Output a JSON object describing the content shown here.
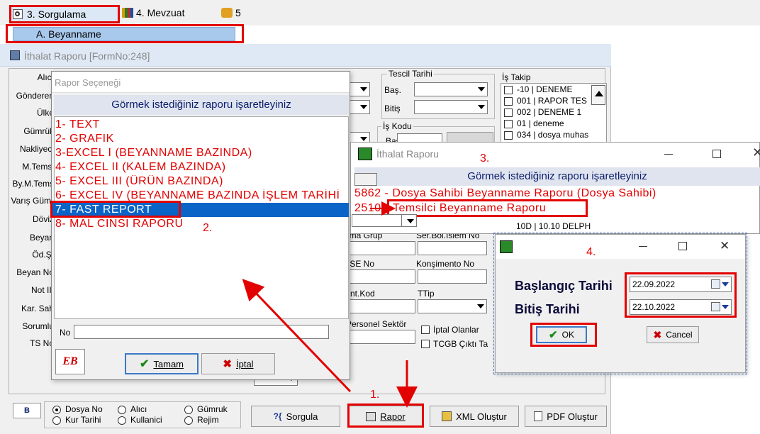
{
  "menu": {
    "sorgulama": "3.  Sorgulama",
    "mevzuat": "4.  Mevzuat",
    "five": "5",
    "beyanname": "A.  Beyanname"
  },
  "main_window": {
    "title": "İthalat Raporu [FormNo:248]",
    "left_labels": [
      "Alıcı",
      "Gönderen",
      "Ülke",
      "Gümrük",
      "Nakliyeci",
      "M.Temsi",
      "By.M.Tems",
      "Varış Gümr",
      "Döviz",
      "Beyan",
      "Öd.Ş.",
      "Beyan No",
      "Not III",
      "Kar. Sah",
      "Sorumlu",
      "TS No"
    ],
    "tescil_title": "Tescil Tarihi",
    "bas_label": "Baş.",
    "bitis_label": "Bitiş",
    "is_takip_title": "İş Takip",
    "is_takip_items": [
      "-10 | DENEME",
      "001 | RAPOR TES",
      "002 | DENEME 1",
      "01 | deneme",
      "034 | dosya muhas"
    ],
    "is_kodu_title": "İş Kodu",
    "bas2_label": "Baş",
    "list_item_10d": "10D | 10.10 DELPH",
    "firma_grup": "irma Grup",
    "ser_bol": "Ser.Bol.Islem No",
    "tse_no": "TSE No",
    "konsimento": "Konşimento No",
    "ant_kod": "Ant.Kod",
    "ttip": "TTip",
    "personel": "Personel Sektör",
    "iptal_olanlar": "İptal Olanlar",
    "tcgb": "TCGB Çıktı Ta",
    "radios": [
      "Dosya No",
      "Alıcı",
      "Gümruk",
      "Kur Tarihi",
      "Kullanici",
      "Rejim"
    ],
    "buttons": {
      "sorgula": "Sorgula",
      "rapor": "Rapor",
      "xml": "XML Oluştur",
      "pdf": "PDF Oluştur"
    }
  },
  "rapor_dialog": {
    "title": "Rapor Seçeneği",
    "header": "Görmek istediğiniz raporu işaretleyiniz",
    "items": [
      "1- TEXT",
      "2- GRAFIK",
      "3-EXCEL I (BEYANNAME BAZINDA)",
      "4- EXCEL II (KALEM BAZINDA)",
      "5- EXCEL III (ÜRÜN BAZINDA)",
      "6- EXCEL IV (BEYANNAME BAZINDA İŞLEM TARİHİ",
      "7- FAST REPORT",
      "8- MAL CINSI RAPORU"
    ],
    "no_label": "No",
    "ok": "Tamam",
    "cancel": "İptal",
    "logo": "EB"
  },
  "ithalat_dialog": {
    "title": "İthalat Raporu",
    "header": "Görmek istediğiniz raporu işaretleyiniz",
    "item1": "5862 - Dosya Sahibi Beyanname Raporu (Dosya Sahibi)",
    "item2_prefix": "2510 -",
    "item2": "Temsilci Beyanname Raporu"
  },
  "date_dialog": {
    "start_label": "Başlangıç Tarihi",
    "end_label": "Bitiş Tarihi",
    "start_value": "22.09.2022",
    "end_value": "22.10.2022",
    "ok": "OK",
    "cancel": "Cancel"
  },
  "annotations": {
    "a1": "1.",
    "a2": "2.",
    "a3": "3.",
    "a4": "4."
  },
  "colors": {
    "annotation_red": "#e30000",
    "selection_blue": "#0a64c8",
    "header_navy": "#0a1e6e"
  }
}
